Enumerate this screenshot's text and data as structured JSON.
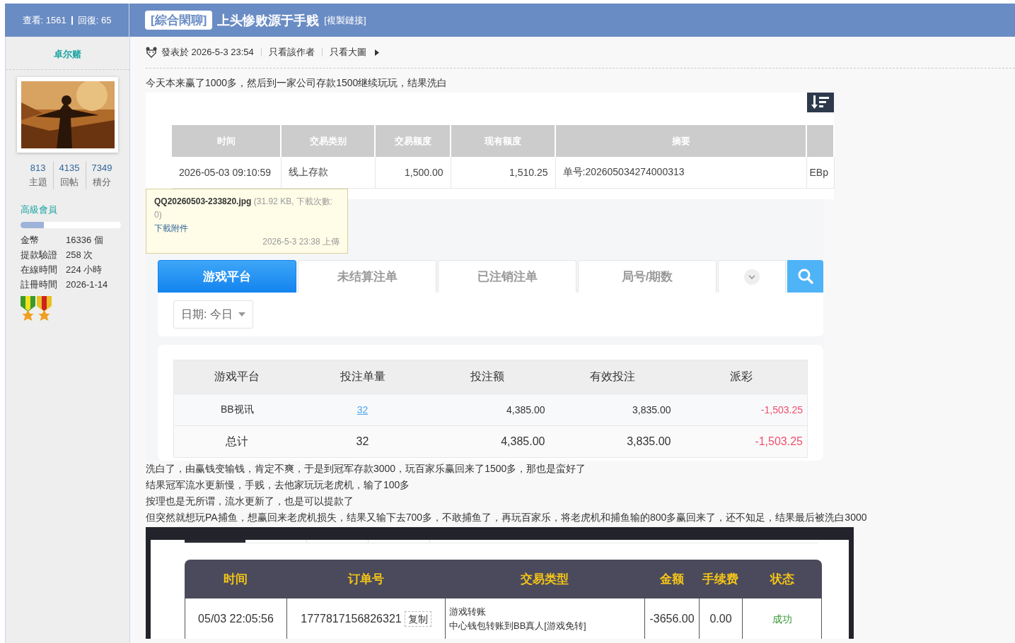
{
  "header": {
    "views": "查看: 1561",
    "replies": "回復: 65",
    "category": "[綜合閑聊]",
    "title": "上头惨败源于手贱",
    "copy_link": "[複製鏈接]"
  },
  "author": {
    "name": "卓尔赌",
    "stats": [
      {
        "value": "813",
        "label": "主題"
      },
      {
        "value": "4135",
        "label": "回帖"
      },
      {
        "value": "7349",
        "label": "積分"
      }
    ],
    "group": "高級會員",
    "level": 0.23,
    "info": [
      {
        "label": "金幣",
        "value": "16336 個"
      },
      {
        "label": "提款驗證",
        "value": "258 次"
      },
      {
        "label": "在線時間",
        "value": "224 小時"
      },
      {
        "label": "註冊時間",
        "value": "2026-1-14"
      }
    ]
  },
  "post": {
    "posted": "發表於 2026-5-3 23:54",
    "links": [
      "只看該作者",
      "只看大圖"
    ],
    "content": [
      {
        "kind": "text",
        "lines": [
          "今天本来赢了1000多，然后到一家公司存款1500继续玩玩，结果洗白"
        ]
      },
      {
        "kind": "ledger",
        "columns": [
          "时间",
          "交易类别",
          "交易额度",
          "现有额度",
          "摘要"
        ],
        "row": [
          "2026-05-03 09:10:59",
          "线上存款",
          "1,500.00",
          "1,510.25",
          "单号:202605034274000313",
          "EBp"
        ],
        "attachment": {
          "name": "QQ20260503-233820.jpg",
          "info": "(31.92 KB, 下載次數: 0)",
          "download": "下載附件",
          "uploaded": "2026-5-3 23:38 上傳"
        }
      },
      {
        "kind": "bets",
        "tabs": [
          {
            "label": "游戏平台",
            "selected": true
          },
          {
            "label": "未结算注单",
            "selected": false
          },
          {
            "label": "已注销注单",
            "selected": false
          },
          {
            "label": "局号/期数",
            "selected": false
          }
        ],
        "dropdown": {
          "expanded": false
        },
        "filter": "日期: 今日",
        "columns": [
          "游戏平台",
          "投注单量",
          "投注额",
          "有效投注",
          "派彩"
        ],
        "rows": [
          {
            "kind": "data",
            "cells": [
              "BB视讯",
              "32",
              "4,385.00",
              "3,835.00",
              "-1,503.25"
            ]
          },
          {
            "kind": "total",
            "cells": [
              "总计",
              "32",
              "4,385.00",
              "3,835.00",
              "-1,503.25"
            ]
          }
        ]
      },
      {
        "kind": "text",
        "lines": [
          "洗白了，由赢钱变输钱，肯定不爽，于是到冠军存款3000，玩百家乐赢回来了1500多，那也是蛮好了",
          "结果冠军流水更新慢，手贱，去他家玩玩老虎机，输了100多",
          "按理也是无所谓，流水更新了，也是可以提款了",
          "但突然就想玩PA捕鱼，想赢回来老虎机损失，结果又输下去700多，不敢捕鱼了，再玩百家乐，将老虎机和捕鱼输的800多赢回来了，还不知足，结果最后被洗白3000"
        ]
      },
      {
        "kind": "orders",
        "columns": [
          "时间",
          "订单号",
          "交易类型",
          "金额",
          "手续费",
          "状态"
        ],
        "row": {
          "time": "05/03 22:05:56",
          "order": "1777817156826321",
          "copy": "复制",
          "type": "游戏转账",
          "detail": "中心钱包转账到BB真人[游戏免转]",
          "amount": "-3656.00",
          "fee": "0.00",
          "status": "成功"
        }
      }
    ]
  }
}
